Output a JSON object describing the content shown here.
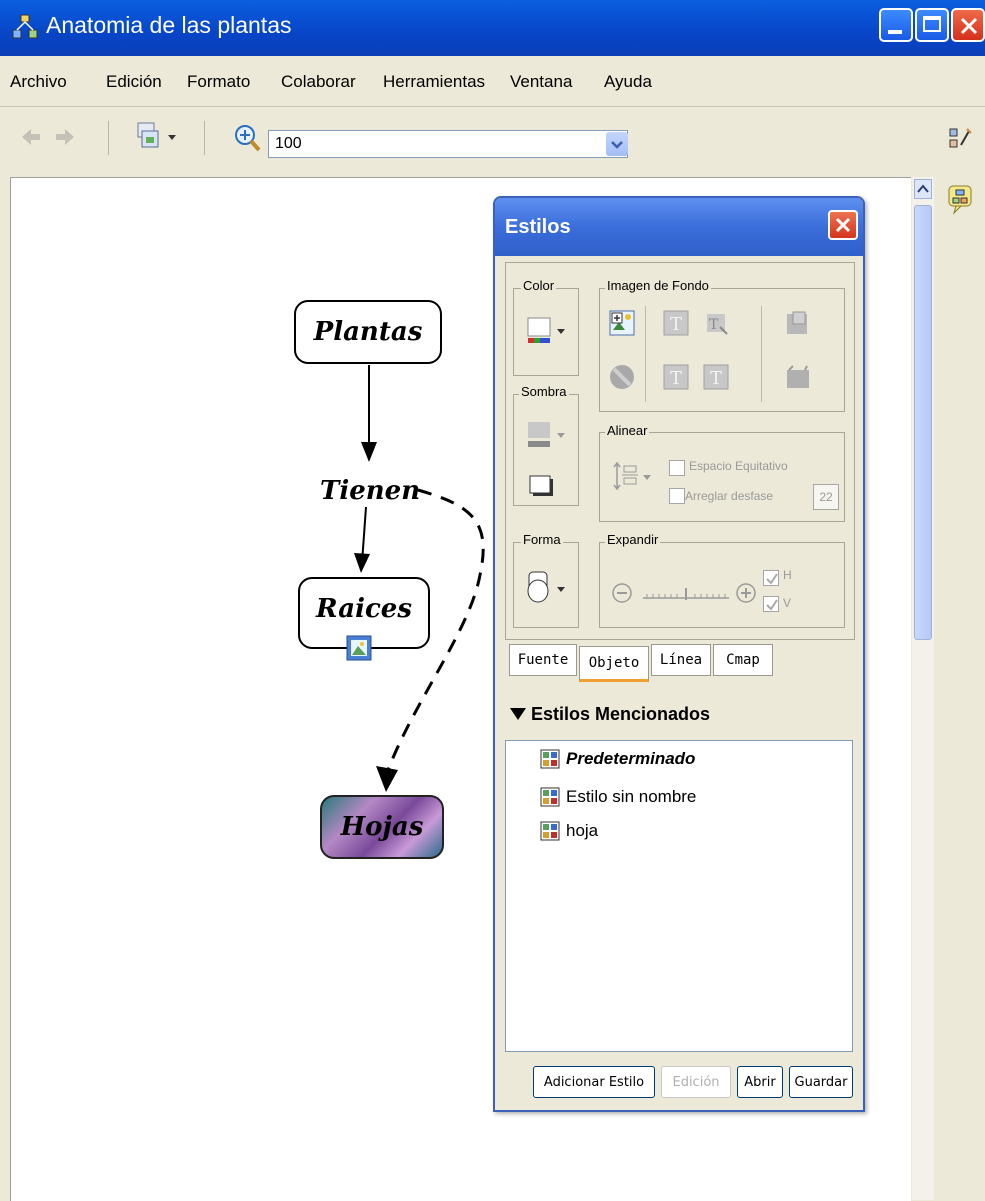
{
  "window": {
    "title": "Anatomia de las plantas"
  },
  "menu": [
    "Archivo",
    "Edición",
    "Formato",
    "Colaborar",
    "Herramientas",
    "Ventana",
    "Ayuda"
  ],
  "toolbar": {
    "zoom_value": "100"
  },
  "concept_map": {
    "nodes": {
      "plantas": "Plantas",
      "tienen": "Tienen",
      "raices": "Raices",
      "hojas": "Hojas"
    }
  },
  "estilos": {
    "title": "Estilos",
    "groups": {
      "color": "Color",
      "imagen_fondo": "Imagen de Fondo",
      "sombra": "Sombra",
      "alinear": "Alinear",
      "forma": "Forma",
      "expandir": "Expandir"
    },
    "alinear_options": {
      "espacio": "Espacio Equitativo",
      "arreglar": "Arreglar desfase",
      "arreglar_value": "22"
    },
    "expandir_options": {
      "h": "H",
      "v": "V"
    },
    "tabs": [
      "Fuente",
      "Objeto",
      "Línea",
      "Cmap"
    ],
    "active_tab": "Objeto",
    "section_title": "Estilos Mencionados",
    "styles": [
      "Predeterminado",
      "Estilo sin nombre",
      "hoja"
    ],
    "buttons": {
      "add": "Adicionar Estilo",
      "edit": "Edición",
      "open": "Abrir",
      "save": "Guardar"
    }
  },
  "colors": {
    "titlebar": "#0845c7",
    "dialog_title": "#3b6edb",
    "close": "#d4301a",
    "active_tab_underline": "#f0a030"
  }
}
